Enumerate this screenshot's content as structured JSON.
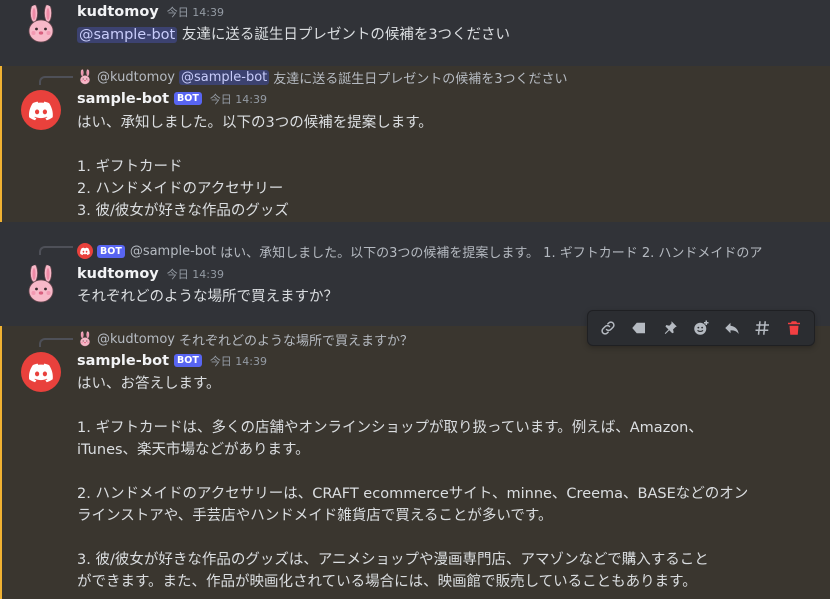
{
  "messages": [
    {
      "author": "kudtomoy",
      "timestamp": "今日 14:39",
      "mention": "@sample-bot",
      "text": "友達に送る誕生日プレゼントの候補を3つください"
    },
    {
      "reply": {
        "author": "@kudtomoy",
        "mention": "@sample-bot",
        "text": "友達に送る誕生日プレゼントの候補を3つください"
      },
      "author": "sample-bot",
      "badge": "BOT",
      "timestamp": "今日 14:39",
      "lines": [
        "はい、承知しました。以下の3つの候補を提案します。",
        "1. ギフトカード",
        "2. ハンドメイドのアクセサリー",
        "3. 彼/彼女が好きな作品のグッズ"
      ]
    },
    {
      "reply": {
        "badge": "BOT",
        "author": "@sample-bot",
        "text": "はい、承知しました。以下の3つの候補を提案します。 1. ギフトカード 2. ハンドメイドのア"
      },
      "author": "kudtomoy",
      "timestamp": "今日 14:39",
      "text": "それぞれどのような場所で買えますか？"
    },
    {
      "reply": {
        "author": "@kudtomoy",
        "text": "それぞれどのような場所で買えますか？"
      },
      "author": "sample-bot",
      "badge": "BOT",
      "timestamp": "今日 14:39",
      "paragraphs": [
        [
          "はい、お答えします。"
        ],
        [
          "1. ギフトカードは、多くの店舗やオンラインショップが取り扱っています。例えば、Amazon、",
          "iTunes、楽天市場などがあります。"
        ],
        [
          "2. ハンドメイドのアクセサリーは、CRAFT ecommerceサイト、minne、Creema、BASEなどのオン",
          "ラインストアや、手芸店やハンドメイド雑貨店で買えることが多いです。"
        ],
        [
          "3. 彼/彼女が好きな作品のグッズは、アニメショップや漫画専門店、アマゾンなどで購入すること",
          "ができます。また、作品が映画化されている場合には、映画館で販売していることもあります。"
        ]
      ]
    }
  ],
  "toolbar": {
    "buttons": [
      "link-icon",
      "tag-icon",
      "pin-icon",
      "add-reaction-icon",
      "reply-icon",
      "thread-icon",
      "trash-icon"
    ]
  },
  "colors": {
    "background": "#313338",
    "mention_highlight": "#3a362f",
    "mention_bar": "#f0b232",
    "bot_badge": "#5865f2",
    "bot_avatar": "#e9413c",
    "delete": "#f23f42"
  }
}
